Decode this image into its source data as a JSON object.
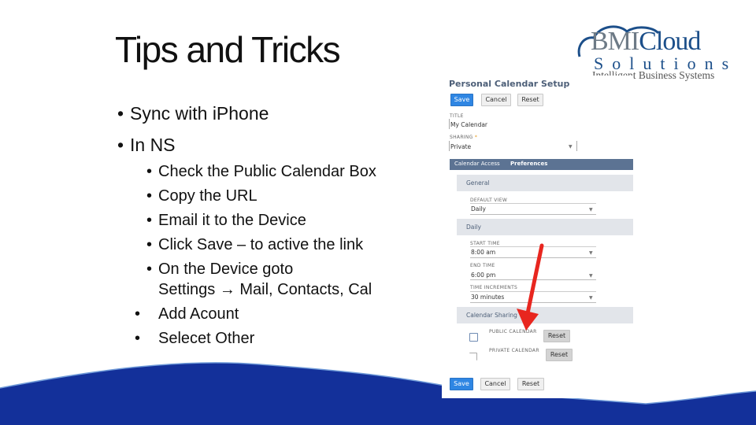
{
  "slide": {
    "title": "Tips and Tricks",
    "bullets_l1": [
      "Sync with iPhone",
      "In NS"
    ],
    "bullet_glyph": "•",
    "bullets_l2": [
      {
        "text": "Check the Public Calendar Box"
      },
      {
        "text": "Copy the URL"
      },
      {
        "text": "Email it to the Device"
      },
      {
        "text": "Click Save – to active the link"
      },
      {
        "text": "On the Device goto",
        "continuation": "Settings → Mail, Contacts, Cal"
      }
    ],
    "bullets_l1b": [
      " Add Acount",
      "Selecet Other"
    ]
  },
  "logo": {
    "bmi": "BMI",
    "cloud": "Cloud",
    "solutions": "Solutions",
    "tagline": "Intelligent Business Systems"
  },
  "screenshot": {
    "heading": "Personal Calendar Setup",
    "top_buttons": {
      "save": "Save",
      "cancel": "Cancel",
      "reset": "Reset"
    },
    "title_label": "TITLE",
    "title_value": "My Calendar",
    "sharing_label": "SHARING",
    "sharing_required": "*",
    "sharing_value": "Private",
    "tabs": [
      "Calendar Access",
      "Preferences"
    ],
    "active_tab": "Preferences",
    "general_section": "General",
    "default_view_label": "DEFAULT VIEW",
    "default_view_value": "Daily",
    "daily_section": "Daily",
    "start_time_label": "START TIME",
    "start_time_value": "8:00 am",
    "end_time_label": "END TIME",
    "end_time_value": "6:00 pm",
    "time_increments_label": "TIME INCREMENTS",
    "time_increments_value": "30 minutes",
    "sharing_section": "Calendar Sharing",
    "public_calendar_label": "PUBLIC CALENDAR",
    "private_calendar_label": "PRIVATE CALENDAR",
    "reset_label": "Reset",
    "bottom_buttons": {
      "save": "Save",
      "cancel": "Cancel",
      "reset": "Reset"
    },
    "caret": "▼"
  },
  "colors": {
    "wave": "#13309a",
    "arrow": "#e8261f",
    "primary_button": "#2f86e3",
    "tab_bar": "#5c7393"
  }
}
